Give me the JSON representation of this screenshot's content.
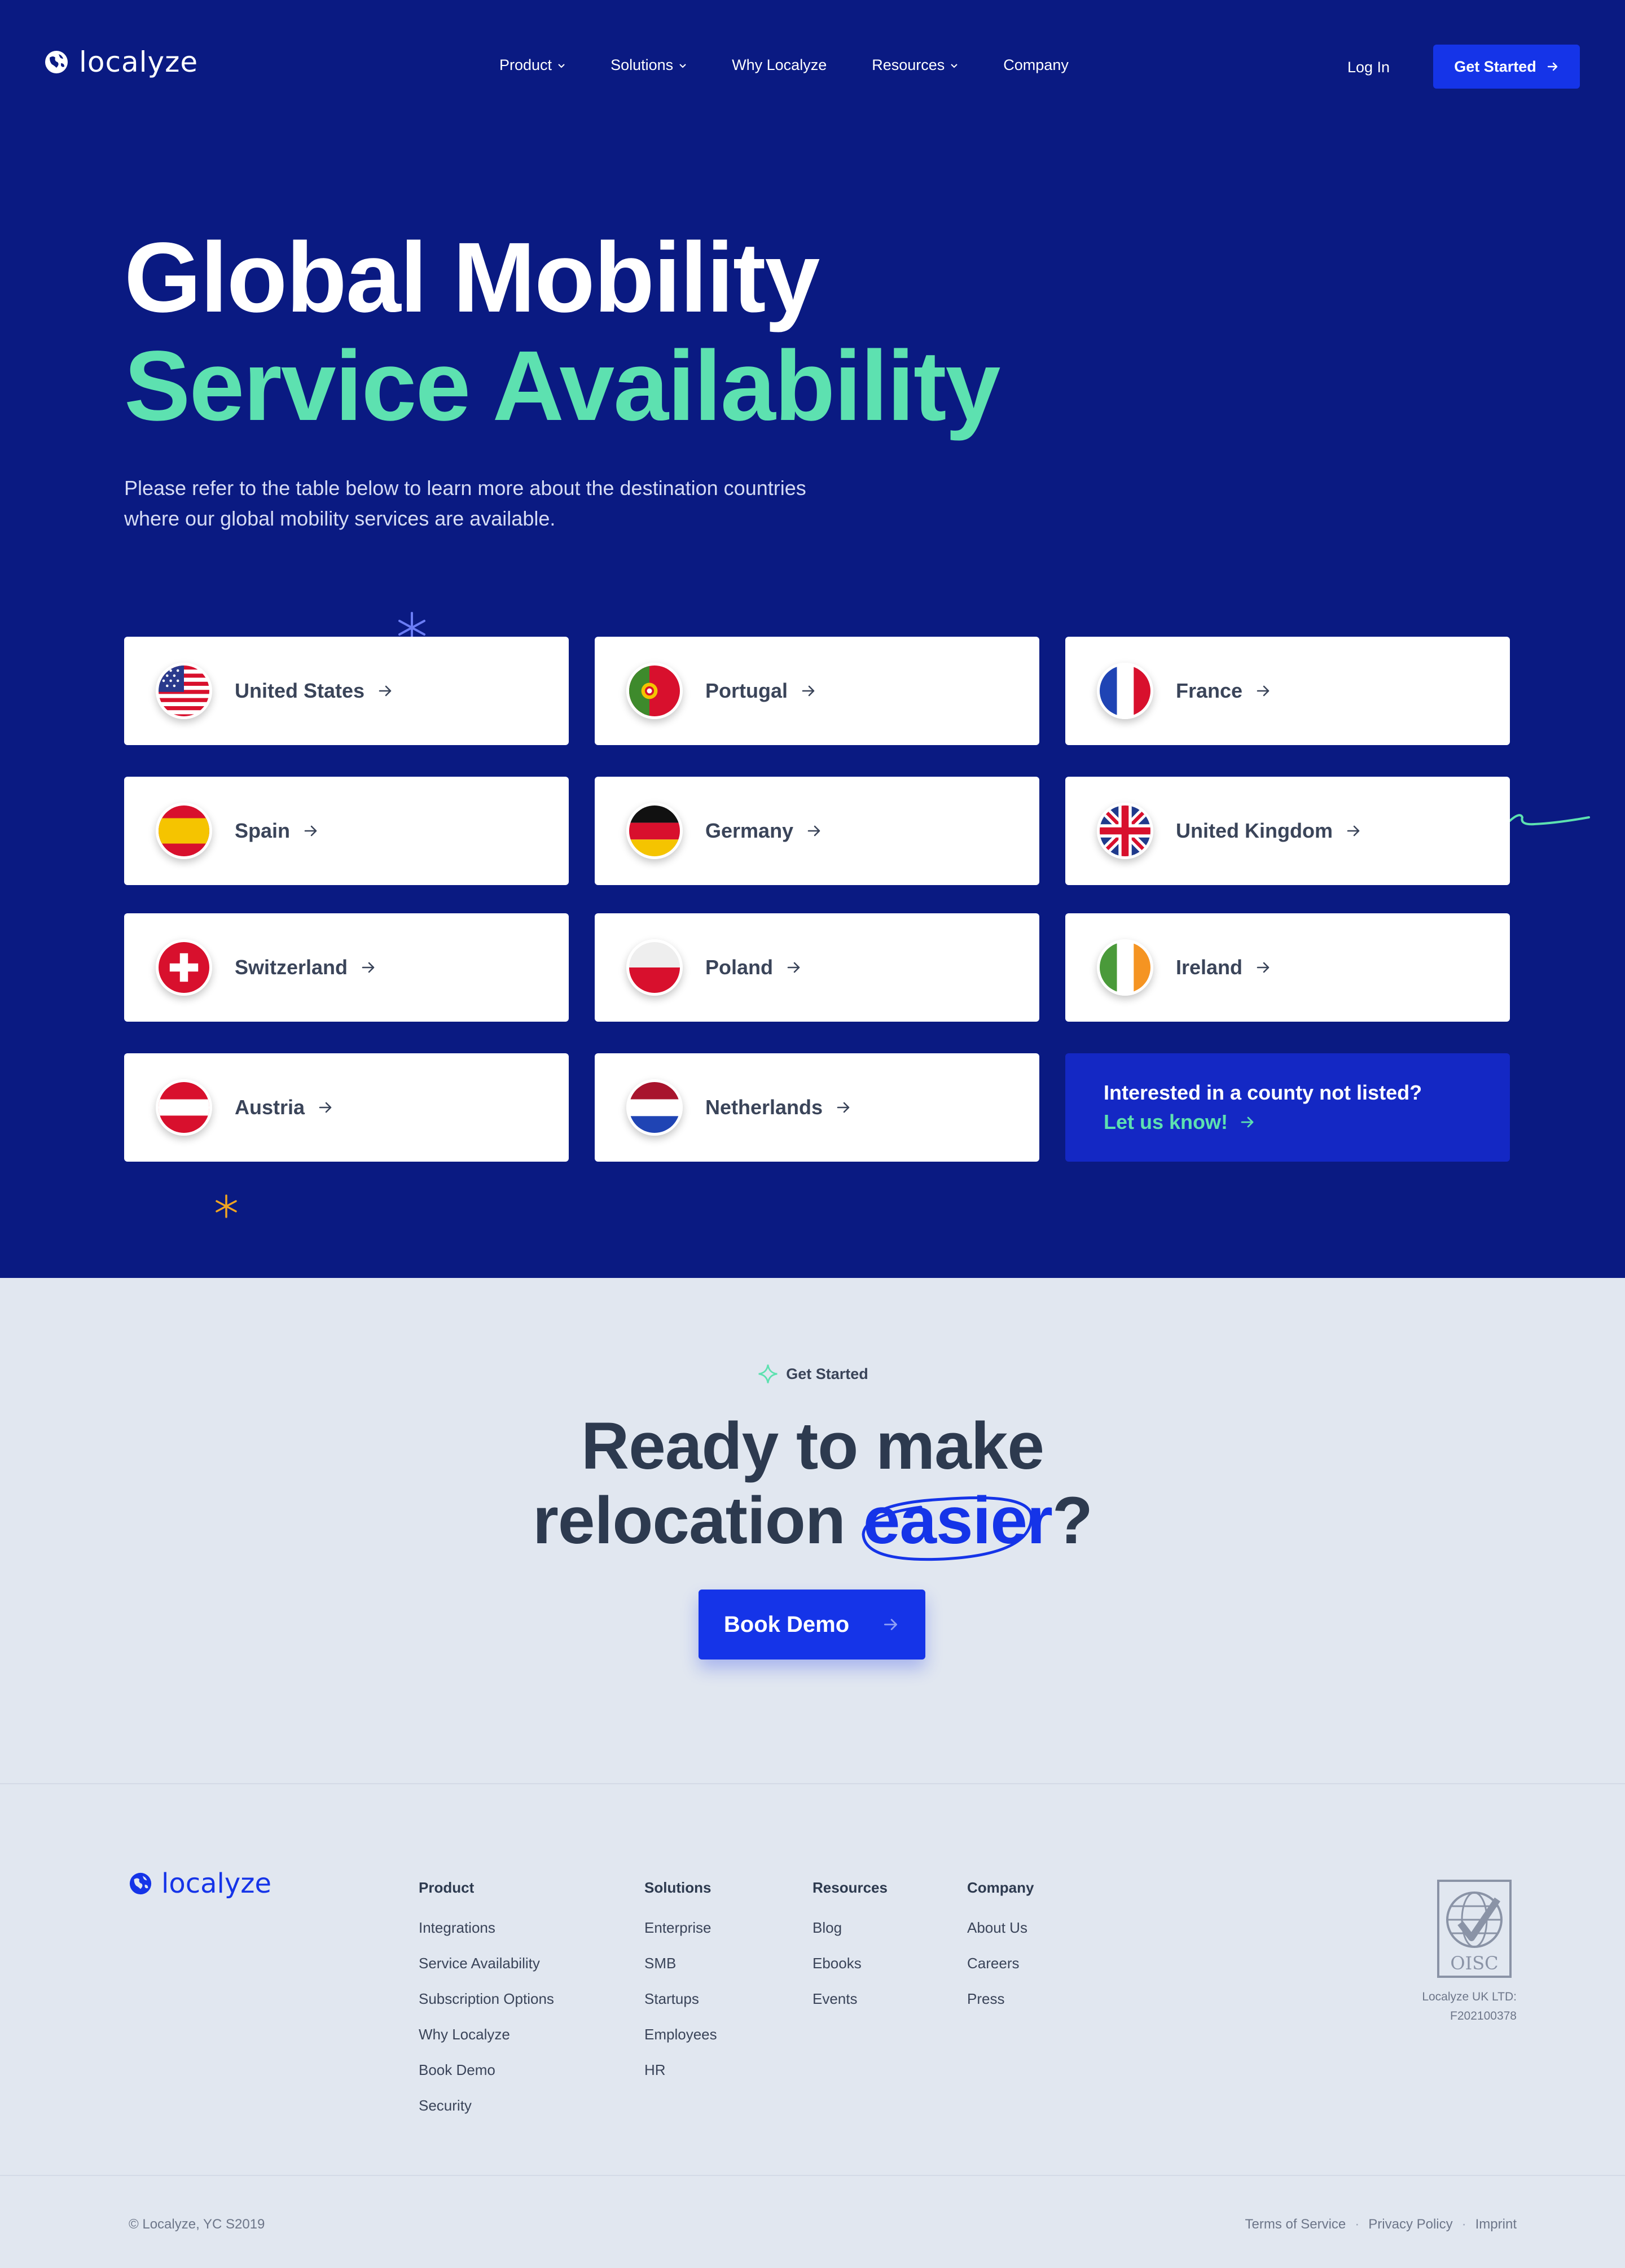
{
  "nav": {
    "logo_text": "localyze",
    "links": [
      {
        "label": "Product",
        "dropdown": true
      },
      {
        "label": "Solutions",
        "dropdown": true
      },
      {
        "label": "Why Localyze",
        "dropdown": false
      },
      {
        "label": "Resources",
        "dropdown": true
      },
      {
        "label": "Company",
        "dropdown": false
      }
    ],
    "login": "Log In",
    "cta": "Get Started"
  },
  "hero": {
    "title_line1": "Global Mobility",
    "title_line2": "Service Availability",
    "description": "Please refer to the table below to learn more about the destination countries where our global mobility services are available."
  },
  "countries": [
    {
      "name": "United States",
      "flag": "us-flag"
    },
    {
      "name": "Portugal",
      "flag": "pt-flag"
    },
    {
      "name": "France",
      "flag": "fr-flag"
    },
    {
      "name": "Spain",
      "flag": "es-flag"
    },
    {
      "name": "Germany",
      "flag": "de-flag"
    },
    {
      "name": "United Kingdom",
      "flag": "gb-flag"
    },
    {
      "name": "Switzerland",
      "flag": "ch-flag"
    },
    {
      "name": "Poland",
      "flag": "pl-flag"
    },
    {
      "name": "Ireland",
      "flag": "ie-flag"
    },
    {
      "name": "Austria",
      "flag": "at-flag"
    },
    {
      "name": "Netherlands",
      "flag": "nl-flag"
    }
  ],
  "not_listed": {
    "title": "Interested in a county not listed?",
    "link": "Let us know!"
  },
  "ready": {
    "eyebrow": "Get Started",
    "title_line1": "Ready to make",
    "title_line2_prefix": "relocation ",
    "title_highlight": "easier",
    "title_suffix": "?",
    "button": "Book Demo"
  },
  "footer": {
    "logo_text": "localyze",
    "columns": [
      {
        "heading": "Product",
        "items": [
          "Integrations",
          "Service Availability",
          "Subscription Options",
          "Why Localyze",
          "Book Demo",
          "Security"
        ]
      },
      {
        "heading": "Solutions",
        "items": [
          "Enterprise",
          "SMB",
          "Startups",
          "Employees",
          "HR"
        ]
      },
      {
        "heading": "Resources",
        "items": [
          "Blog",
          "Ebooks",
          "Events"
        ]
      },
      {
        "heading": "Company",
        "items": [
          "About Us",
          "Careers",
          "Press"
        ]
      }
    ],
    "badge_text": "OISC",
    "company_line1": "Localyze UK LTD:",
    "company_line2": "F202100378",
    "copyright": "© Localyze, YC S2019",
    "legal": [
      "Terms of Service",
      "Privacy Policy",
      "Imprint"
    ]
  },
  "colors": {
    "hero_bg": "#0a1a82",
    "accent_blue": "#1534e8",
    "accent_green": "#5de1b0",
    "page_bg": "#e1e7f0"
  }
}
